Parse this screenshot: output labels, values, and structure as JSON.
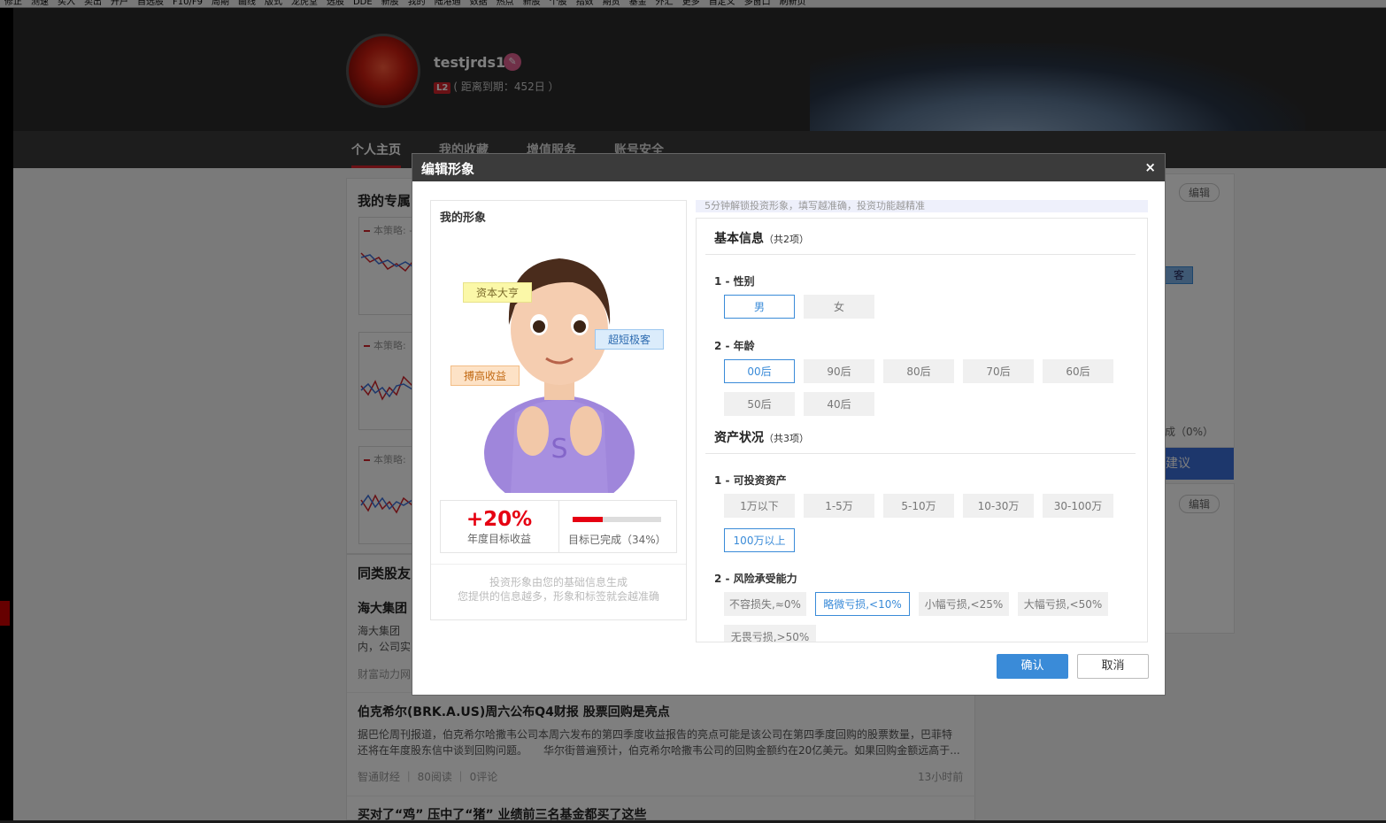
{
  "toolbar": {
    "items": [
      "修正",
      "测速",
      "买入",
      "卖出",
      "开户",
      "自选股",
      "F10/F9",
      "周期",
      "画线",
      "版式",
      "龙虎堂",
      "选股",
      "DDE",
      "新股",
      "我的",
      "陆港通",
      "数据",
      "热点",
      "新股",
      "个股",
      "指数",
      "期货",
      "基金",
      "外汇",
      "更多",
      "自定义",
      "多窗口",
      "刷新页"
    ]
  },
  "profile": {
    "username": "testjrds1",
    "level_badge": "L2",
    "expiry_text": "( 距离到期：452日 ）",
    "nav": [
      "个人主页",
      "我的收藏",
      "增值服务",
      "账号安全"
    ]
  },
  "background": {
    "section_title": "我的专属",
    "strategy_label": "本策略: -",
    "strategy_label2": "本策略:",
    "peer_title": "同类股友",
    "stock_title": "海大集团",
    "stock_desc": "海大集团",
    "stock_desc2": "内，公司实",
    "stock_source": "财富动力网",
    "edit_label": "编辑",
    "side_tag": "客",
    "side_progress": "成（0%）",
    "side_button": "建议",
    "news": [
      {
        "title": "伯克希尔(BRK.A.US)周六公布Q4财报 股票回购是亮点",
        "body1": "据巴伦周刊报道，伯克希尔哈撒韦公司本周六发布的第四季度收益报告的亮点可能是该公司在第四季度回购的股票数量，巴菲特",
        "body2": "还将在年度股东信中谈到回购问题。　　华尔街普遍预计，伯克希尔哈撒韦公司的回购金额约在20亿美元。如果回购金额远高于...",
        "source": "智通财经",
        "reads": "80阅读",
        "comments": "0评论",
        "time": "13小时前"
      },
      {
        "title": "买对了“鸡” 压中了“猪” 业绩前三名基金都买了这些"
      }
    ]
  },
  "modal": {
    "title": "编辑形象",
    "close": "×",
    "left": {
      "title": "我的形象",
      "tags": [
        "资本大亨",
        "超短极客",
        "搏高收益"
      ],
      "target_value": "+20%",
      "target_label": "年度目标收益",
      "progress": 0.34,
      "progress_label": "目标已完成（34%）",
      "note1": "投资形象由您的基础信息生成",
      "note2": "您提供的信息越多，形象和标签就会越准确"
    },
    "hint": "5分钟解锁投资形象，填写越准确，投资功能越精准",
    "sections": [
      {
        "title": "基本信息",
        "count": "（共2项）",
        "questions": [
          {
            "label": "1 - 性别",
            "options": [
              "男",
              "女"
            ],
            "selected": 0
          },
          {
            "label": "2 - 年龄",
            "options": [
              "00后",
              "90后",
              "80后",
              "70后",
              "60后",
              "50后",
              "40后"
            ],
            "selected": 0
          }
        ]
      },
      {
        "title": "资产状况",
        "count": "（共3项）",
        "questions": [
          {
            "label": "1 - 可投资资产",
            "options": [
              "1万以下",
              "1-5万",
              "5-10万",
              "10-30万",
              "30-100万",
              "100万以上"
            ],
            "selected": 5
          },
          {
            "label": "2 - 风险承受能力",
            "options": [
              "不容损失,≈0%",
              "略微亏损,<10%",
              "小幅亏损,<25%",
              "大幅亏损,<50%",
              "无畏亏损,>50%"
            ],
            "selected": 1
          }
        ]
      }
    ],
    "confirm": "确认",
    "cancel": "取消"
  },
  "colors": {
    "accent": "#3a8bd8",
    "brand_red": "#e60012",
    "header_dark": "#3b3b3b"
  }
}
